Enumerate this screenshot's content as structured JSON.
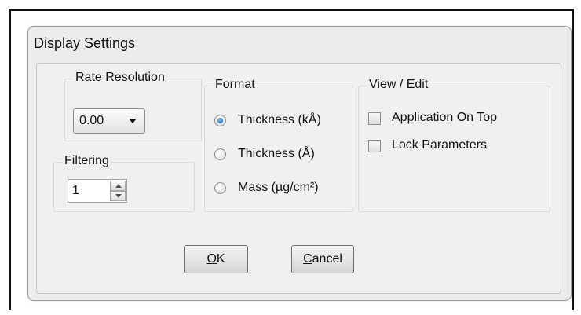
{
  "dialog": {
    "title": "Display Settings"
  },
  "rate_resolution": {
    "label": "Rate Resolution",
    "selected": "0.00"
  },
  "filtering": {
    "label": "Filtering",
    "value": "1"
  },
  "format": {
    "label": "Format",
    "options": [
      {
        "label": "Thickness (kÅ)",
        "checked": true
      },
      {
        "label": "Thickness (Å)",
        "checked": false
      },
      {
        "label": "Mass (µg/cm²)",
        "checked": false
      }
    ]
  },
  "view_edit": {
    "label": "View / Edit",
    "options": [
      {
        "label": "Application On Top",
        "checked": false
      },
      {
        "label": "Lock Parameters",
        "checked": false
      }
    ]
  },
  "buttons": {
    "ok": {
      "mnemonic": "O",
      "rest": "K"
    },
    "cancel": {
      "mnemonic": "C",
      "rest": "ancel"
    }
  }
}
